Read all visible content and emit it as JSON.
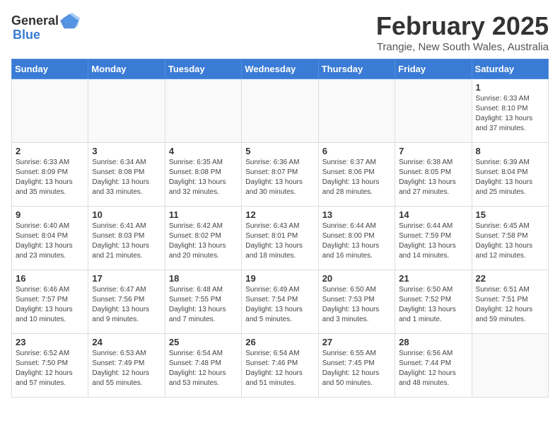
{
  "logo": {
    "general": "General",
    "blue": "Blue"
  },
  "title": "February 2025",
  "location": "Trangie, New South Wales, Australia",
  "days_of_week": [
    "Sunday",
    "Monday",
    "Tuesday",
    "Wednesday",
    "Thursday",
    "Friday",
    "Saturday"
  ],
  "weeks": [
    [
      {
        "day": "",
        "info": ""
      },
      {
        "day": "",
        "info": ""
      },
      {
        "day": "",
        "info": ""
      },
      {
        "day": "",
        "info": ""
      },
      {
        "day": "",
        "info": ""
      },
      {
        "day": "",
        "info": ""
      },
      {
        "day": "1",
        "info": "Sunrise: 6:33 AM\nSunset: 8:10 PM\nDaylight: 13 hours and 37 minutes."
      }
    ],
    [
      {
        "day": "2",
        "info": "Sunrise: 6:33 AM\nSunset: 8:09 PM\nDaylight: 13 hours and 35 minutes."
      },
      {
        "day": "3",
        "info": "Sunrise: 6:34 AM\nSunset: 8:08 PM\nDaylight: 13 hours and 33 minutes."
      },
      {
        "day": "4",
        "info": "Sunrise: 6:35 AM\nSunset: 8:08 PM\nDaylight: 13 hours and 32 minutes."
      },
      {
        "day": "5",
        "info": "Sunrise: 6:36 AM\nSunset: 8:07 PM\nDaylight: 13 hours and 30 minutes."
      },
      {
        "day": "6",
        "info": "Sunrise: 6:37 AM\nSunset: 8:06 PM\nDaylight: 13 hours and 28 minutes."
      },
      {
        "day": "7",
        "info": "Sunrise: 6:38 AM\nSunset: 8:05 PM\nDaylight: 13 hours and 27 minutes."
      },
      {
        "day": "8",
        "info": "Sunrise: 6:39 AM\nSunset: 8:04 PM\nDaylight: 13 hours and 25 minutes."
      }
    ],
    [
      {
        "day": "9",
        "info": "Sunrise: 6:40 AM\nSunset: 8:04 PM\nDaylight: 13 hours and 23 minutes."
      },
      {
        "day": "10",
        "info": "Sunrise: 6:41 AM\nSunset: 8:03 PM\nDaylight: 13 hours and 21 minutes."
      },
      {
        "day": "11",
        "info": "Sunrise: 6:42 AM\nSunset: 8:02 PM\nDaylight: 13 hours and 20 minutes."
      },
      {
        "day": "12",
        "info": "Sunrise: 6:43 AM\nSunset: 8:01 PM\nDaylight: 13 hours and 18 minutes."
      },
      {
        "day": "13",
        "info": "Sunrise: 6:44 AM\nSunset: 8:00 PM\nDaylight: 13 hours and 16 minutes."
      },
      {
        "day": "14",
        "info": "Sunrise: 6:44 AM\nSunset: 7:59 PM\nDaylight: 13 hours and 14 minutes."
      },
      {
        "day": "15",
        "info": "Sunrise: 6:45 AM\nSunset: 7:58 PM\nDaylight: 13 hours and 12 minutes."
      }
    ],
    [
      {
        "day": "16",
        "info": "Sunrise: 6:46 AM\nSunset: 7:57 PM\nDaylight: 13 hours and 10 minutes."
      },
      {
        "day": "17",
        "info": "Sunrise: 6:47 AM\nSunset: 7:56 PM\nDaylight: 13 hours and 9 minutes."
      },
      {
        "day": "18",
        "info": "Sunrise: 6:48 AM\nSunset: 7:55 PM\nDaylight: 13 hours and 7 minutes."
      },
      {
        "day": "19",
        "info": "Sunrise: 6:49 AM\nSunset: 7:54 PM\nDaylight: 13 hours and 5 minutes."
      },
      {
        "day": "20",
        "info": "Sunrise: 6:50 AM\nSunset: 7:53 PM\nDaylight: 13 hours and 3 minutes."
      },
      {
        "day": "21",
        "info": "Sunrise: 6:50 AM\nSunset: 7:52 PM\nDaylight: 13 hours and 1 minute."
      },
      {
        "day": "22",
        "info": "Sunrise: 6:51 AM\nSunset: 7:51 PM\nDaylight: 12 hours and 59 minutes."
      }
    ],
    [
      {
        "day": "23",
        "info": "Sunrise: 6:52 AM\nSunset: 7:50 PM\nDaylight: 12 hours and 57 minutes."
      },
      {
        "day": "24",
        "info": "Sunrise: 6:53 AM\nSunset: 7:49 PM\nDaylight: 12 hours and 55 minutes."
      },
      {
        "day": "25",
        "info": "Sunrise: 6:54 AM\nSunset: 7:48 PM\nDaylight: 12 hours and 53 minutes."
      },
      {
        "day": "26",
        "info": "Sunrise: 6:54 AM\nSunset: 7:46 PM\nDaylight: 12 hours and 51 minutes."
      },
      {
        "day": "27",
        "info": "Sunrise: 6:55 AM\nSunset: 7:45 PM\nDaylight: 12 hours and 50 minutes."
      },
      {
        "day": "28",
        "info": "Sunrise: 6:56 AM\nSunset: 7:44 PM\nDaylight: 12 hours and 48 minutes."
      },
      {
        "day": "",
        "info": ""
      }
    ]
  ]
}
